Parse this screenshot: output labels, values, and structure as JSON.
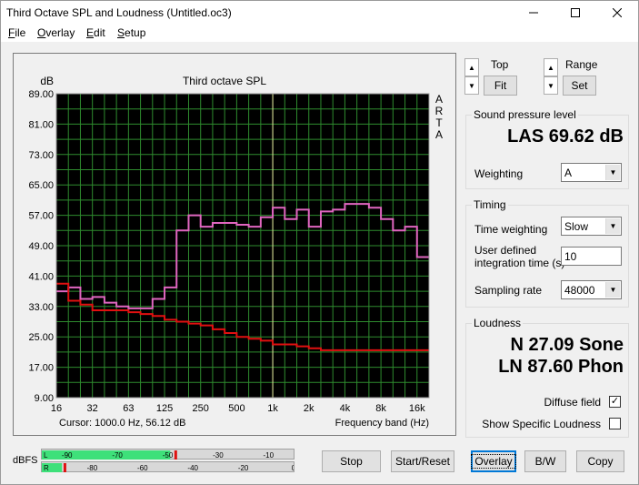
{
  "window": {
    "title": "Third Octave SPL and Loudness (Untitled.oc3)"
  },
  "menu": {
    "items": [
      {
        "u": "F",
        "rest": "ile"
      },
      {
        "u": "O",
        "rest": "verlay"
      },
      {
        "u": "E",
        "rest": "dit"
      },
      {
        "u": "S",
        "rest": "etup"
      }
    ]
  },
  "chart_data": {
    "type": "line",
    "title": "Third octave SPL",
    "ylabel": "dB",
    "xlabel": "Frequency band (Hz)",
    "side_label": [
      "A",
      "R",
      "T",
      "A"
    ],
    "ylim": [
      9,
      89
    ],
    "y_ticks": [
      "89.00",
      "81.00",
      "73.00",
      "65.00",
      "57.00",
      "49.00",
      "41.00",
      "33.00",
      "25.00",
      "17.00",
      "9.00"
    ],
    "x_ticks": [
      "16",
      "32",
      "63",
      "125",
      "250",
      "500",
      "1k",
      "2k",
      "4k",
      "8k",
      "16k"
    ],
    "x_bands": [
      16,
      20,
      25,
      31.5,
      40,
      50,
      63,
      80,
      100,
      125,
      160,
      200,
      250,
      315,
      400,
      500,
      630,
      800,
      1000,
      1250,
      1600,
      2000,
      2500,
      3150,
      4000,
      5000,
      6300,
      8000,
      10000,
      12500,
      16000,
      20000
    ],
    "series": [
      {
        "color": "#e066c0",
        "values": [
          37,
          38,
          35,
          35.5,
          34,
          33,
          32.5,
          32.5,
          35,
          38,
          53,
          57,
          54,
          55,
          55,
          54.5,
          54,
          56.5,
          59,
          56,
          58.5,
          54,
          58,
          58.5,
          60,
          60,
          59,
          56,
          53,
          54,
          46
        ]
      },
      {
        "color": "#e01010",
        "values": [
          39,
          34.5,
          33.5,
          32,
          32,
          32,
          31.5,
          31,
          30.5,
          29.5,
          29,
          28.5,
          28,
          27,
          26,
          25,
          24.5,
          24,
          23,
          23,
          22.5,
          22,
          21.5,
          21.5,
          21.5,
          21.5,
          21.5,
          21.5,
          21.5,
          21.5,
          21.5
        ]
      }
    ],
    "cursor_x": 1000,
    "cursor_text": "Cursor:  1000.0 Hz, 56.12 dB"
  },
  "controls": {
    "top_label": "Top",
    "range_label": "Range",
    "fit_label": "Fit",
    "set_label": "Set",
    "up_glyph": "▲",
    "down_glyph": "▼"
  },
  "spl": {
    "group_title": "Sound pressure level",
    "value": "LAS 69.62 dB",
    "weighting_label": "Weighting",
    "weighting_value": "A"
  },
  "timing": {
    "group_title": "Timing",
    "time_weighting_label": "Time weighting",
    "time_weighting_value": "Slow",
    "integration_label_1": "User defined",
    "integration_label_2": "integration time (s)",
    "integration_value": "10",
    "sampling_label": "Sampling rate",
    "sampling_value": "48000"
  },
  "loudness": {
    "group_title": "Loudness",
    "n_value": "N 27.09 Sone",
    "ln_value": "LN 87.60 Phon",
    "diffuse_label": "Diffuse field",
    "diffuse_checked": "✓",
    "specific_label": "Show Specific Loudness"
  },
  "meters": {
    "label": "dBFS",
    "l_label": "L",
    "r_label": "R",
    "l_level": 0.51,
    "r_level": 0.08,
    "l_peak": 0.53,
    "r_peak": 0.09,
    "l_ticks": [
      "-90",
      "-70",
      "-50",
      "-30",
      "-10"
    ],
    "r_ticks": [
      "-80",
      "-60",
      "-40",
      "-20",
      "0"
    ]
  },
  "buttons": {
    "stop": "Stop",
    "start_reset": "Start/Reset",
    "overlay": "Overlay",
    "bw": "B/W",
    "copy": "Copy"
  },
  "colors": {
    "plot_bg": "#000000",
    "grid": "#2e8b2e",
    "cursor": "#e8e8a0",
    "meter_fill": "#3ee07a",
    "meter_peak": "#e01010"
  }
}
